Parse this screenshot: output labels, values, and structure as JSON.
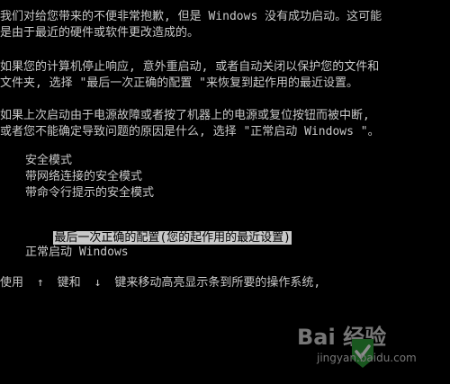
{
  "intro": {
    "line1": "我们对给您带来的不便非常抱歉, 但是 Windows 没有成功启动。这可能",
    "line2": "是由于最近的硬件或软件更改造成的。"
  },
  "para2": {
    "line1": "如果您的计算机停止响应, 意外重启动, 或者自动关闭以保护您的文件和",
    "line2": "文件夹, 选择 \"最后一次正确的配置 \"来恢复到起作用的最近设置。"
  },
  "para3": {
    "line1": "如果上次启动由于电源故障或者按了机器上的电源或复位按钮而被中断,",
    "line2": "或者您不能确定导致问题的原因是什么, 选择 \"正常启动 Windows \"。"
  },
  "menu": {
    "safe_mode": "安全模式",
    "safe_mode_network": "带网络连接的安全模式",
    "safe_mode_cmd": "带命令行提示的安全模式",
    "last_known_good": "最后一次正确的配置(您的起作用的最近设置)",
    "start_normally": "正常启动 Windows"
  },
  "footer": {
    "use": "使用",
    "up_arrow": "↑",
    "and": "键和",
    "down_arrow": "↓",
    "rest": "键来移动高亮显示条到所要的操作系统,"
  },
  "watermark": {
    "logo_text": "Bai 经验",
    "url": "jingyan.baidu.com"
  },
  "colors": {
    "background": "#000000",
    "text": "#c8c8c8",
    "highlight_bg": "#c8c8c8",
    "highlight_fg": "#000000",
    "watermark_green": "#2e9e3a"
  }
}
